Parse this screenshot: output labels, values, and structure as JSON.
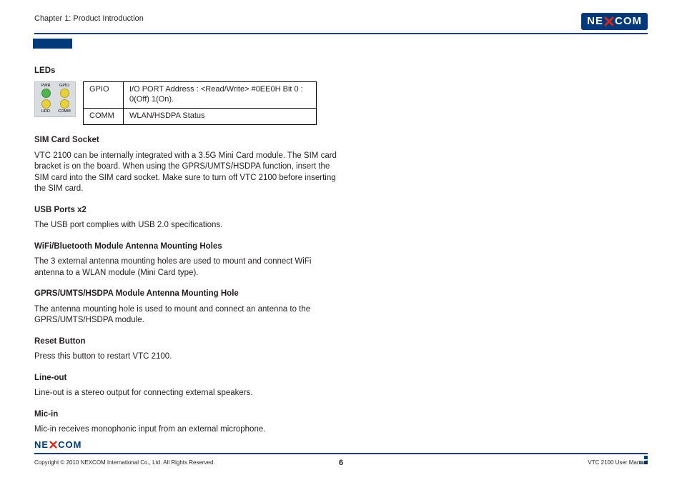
{
  "header": {
    "chapter": "Chapter 1: Product Introduction",
    "logo_left": "NE",
    "logo_right": "COM"
  },
  "leds": {
    "heading": "LEDs",
    "diagram": {
      "top_left_label": "PWR",
      "top_right_label": "GPIO",
      "bottom_left_label": "HDD",
      "bottom_right_label": "COMM"
    },
    "table": [
      {
        "k": "GPIO",
        "v": "I/O PORT Address : <Read/Write>  #0EE0H Bit 0 : 0(Off) 1(On)."
      },
      {
        "k": "COMM",
        "v": "WLAN/HSDPA Status"
      }
    ]
  },
  "sections": {
    "sim": {
      "h": "SIM Card Socket",
      "p": "VTC 2100 can be internally integrated with a 3.5G Mini Card module. The SIM card bracket is on the board. When using the GPRS/UMTS/HSDPA function, insert the SIM card into the SIM card socket. Make sure to turn off VTC 2100 before inserting the SIM card."
    },
    "usb": {
      "h": "USB Ports x2",
      "p": "The USB port complies with USB 2.0 specifications."
    },
    "wifi": {
      "h": "WiFi/Bluetooth Module Antenna Mounting Holes",
      "p": "The 3 external antenna mounting holes are used to mount and connect WiFi antenna to a WLAN module (Mini Card type)."
    },
    "gprs": {
      "h": "GPRS/UMTS/HSDPA Module Antenna Mounting Hole",
      "p": "The antenna mounting hole is used to mount and connect an antenna to the GPRS/UMTS/HSDPA module."
    },
    "reset": {
      "h": "Reset Button",
      "p": "Press this button to restart VTC 2100."
    },
    "lineout": {
      "h": "Line-out",
      "p": "Line-out is a stereo output for connecting external speakers."
    },
    "micin": {
      "h": "Mic-in",
      "p": "Mic-in receives monophonic input from an external microphone."
    }
  },
  "footer": {
    "copyright": "Copyright © 2010 NEXCOM International Co., Ltd. All Rights Reserved.",
    "page": "6",
    "manual": "VTC 2100 User Manual",
    "logo_left": "NE",
    "logo_right": "COM"
  }
}
